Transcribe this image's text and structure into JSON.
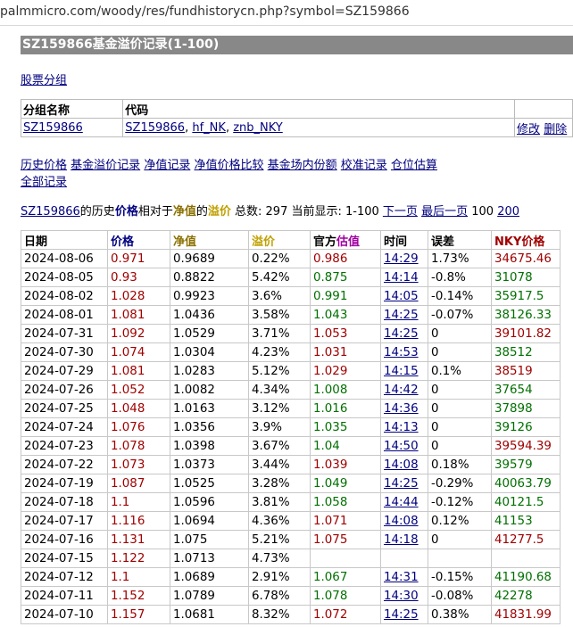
{
  "browser": {
    "url": "palmmicro.com/woody/res/fundhistorycn.php?symbol=SZ159866"
  },
  "page": {
    "title": "SZ159866基金溢价记录(1-100)",
    "group_link": "股票分组"
  },
  "group_table": {
    "headers": [
      "分组名称",
      "代码",
      ""
    ],
    "row": {
      "name": "SZ159866",
      "codes": [
        "SZ159866",
        "hf_NK",
        "znb_NKY"
      ],
      "actions": [
        "修改",
        "删除"
      ]
    }
  },
  "nav_links": [
    "历史价格",
    "基金溢价记录",
    "净值记录",
    "净值价格比较",
    "基金场内份额",
    "校准记录",
    "仓位估算",
    "全部记录"
  ],
  "summary": {
    "symbol": "SZ159866",
    "t1": "的历史",
    "price": "价格",
    "t2": "相对于",
    "nav": "净值",
    "t3": "的",
    "premium": "溢价",
    "total": " 总数: 297 当前显示: 1-100 ",
    "next": "下一页",
    "last": "最后一页",
    "n100": "100",
    "n200": "200"
  },
  "colors": {
    "accent_red": "#a00000",
    "accent_green": "#007000",
    "link": "#000080",
    "title_bg": "#888888"
  },
  "history_table": {
    "headers": [
      "日期",
      "价格",
      "净值",
      "溢价",
      "官方",
      "估值",
      "时间",
      "误差",
      "NKY价格"
    ],
    "rows": [
      [
        "2024-08-06",
        "0.971",
        "0.9689",
        "0.22%",
        "0.986",
        "14:29",
        "1.73%",
        "34675.46"
      ],
      [
        "2024-08-05",
        "0.93",
        "0.8822",
        "5.42%",
        "0.875",
        "14:14",
        "-0.8%",
        "31078"
      ],
      [
        "2024-08-02",
        "1.028",
        "0.9923",
        "3.6%",
        "0.991",
        "14:05",
        "-0.14%",
        "35917.5"
      ],
      [
        "2024-08-01",
        "1.081",
        "1.0436",
        "3.58%",
        "1.043",
        "14:25",
        "-0.07%",
        "38126.33"
      ],
      [
        "2024-07-31",
        "1.092",
        "1.0529",
        "3.71%",
        "1.053",
        "14:25",
        "0",
        "39101.82"
      ],
      [
        "2024-07-30",
        "1.074",
        "1.0304",
        "4.23%",
        "1.031",
        "14:53",
        "0",
        "38512"
      ],
      [
        "2024-07-29",
        "1.081",
        "1.0283",
        "5.12%",
        "1.029",
        "14:15",
        "0.1%",
        "38519"
      ],
      [
        "2024-07-26",
        "1.052",
        "1.0082",
        "4.34%",
        "1.008",
        "14:42",
        "0",
        "37654"
      ],
      [
        "2024-07-25",
        "1.048",
        "1.0163",
        "3.12%",
        "1.016",
        "14:36",
        "0",
        "37898"
      ],
      [
        "2024-07-24",
        "1.076",
        "1.0356",
        "3.9%",
        "1.035",
        "14:13",
        "0",
        "39126"
      ],
      [
        "2024-07-23",
        "1.078",
        "1.0398",
        "3.67%",
        "1.04",
        "14:50",
        "0",
        "39594.39"
      ],
      [
        "2024-07-22",
        "1.073",
        "1.0373",
        "3.44%",
        "1.039",
        "14:08",
        "0.18%",
        "39579"
      ],
      [
        "2024-07-19",
        "1.087",
        "1.0525",
        "3.28%",
        "1.049",
        "14:25",
        "-0.29%",
        "40063.79"
      ],
      [
        "2024-07-18",
        "1.1",
        "1.0596",
        "3.81%",
        "1.058",
        "14:44",
        "-0.12%",
        "40121.5"
      ],
      [
        "2024-07-17",
        "1.116",
        "1.0694",
        "4.36%",
        "1.071",
        "14:08",
        "0.12%",
        "41153"
      ],
      [
        "2024-07-16",
        "1.131",
        "1.075",
        "5.21%",
        "1.075",
        "14:18",
        "0",
        "41277.5"
      ],
      [
        "2024-07-15",
        "1.122",
        "1.0713",
        "4.73%",
        "",
        "",
        "",
        ""
      ],
      [
        "2024-07-12",
        "1.1",
        "1.0689",
        "2.91%",
        "1.067",
        "14:31",
        "-0.15%",
        "41190.68"
      ],
      [
        "2024-07-11",
        "1.152",
        "1.0789",
        "6.78%",
        "1.078",
        "14:30",
        "-0.08%",
        "42278"
      ],
      [
        "2024-07-10",
        "1.157",
        "1.0681",
        "8.32%",
        "1.072",
        "14:25",
        "0.38%",
        "41831.99"
      ]
    ],
    "row_colors": {
      "price": [
        "red",
        "red",
        "red",
        "red",
        "red",
        "red",
        "red",
        "red",
        "red",
        "red",
        "red",
        "red",
        "red",
        "red",
        "red",
        "red",
        "red",
        "red",
        "red",
        "red"
      ],
      "estimate": [
        "red",
        "grn",
        "grn",
        "grn",
        "red",
        "red",
        "red",
        "grn",
        "grn",
        "grn",
        "grn",
        "red",
        "grn",
        "grn",
        "red",
        "red",
        "",
        "grn",
        "grn",
        "red"
      ],
      "nky": [
        "red",
        "grn",
        "grn",
        "grn",
        "red",
        "grn",
        "red",
        "grn",
        "grn",
        "grn",
        "red",
        "grn",
        "grn",
        "grn",
        "grn",
        "red",
        "",
        "grn",
        "grn",
        "red"
      ]
    }
  }
}
